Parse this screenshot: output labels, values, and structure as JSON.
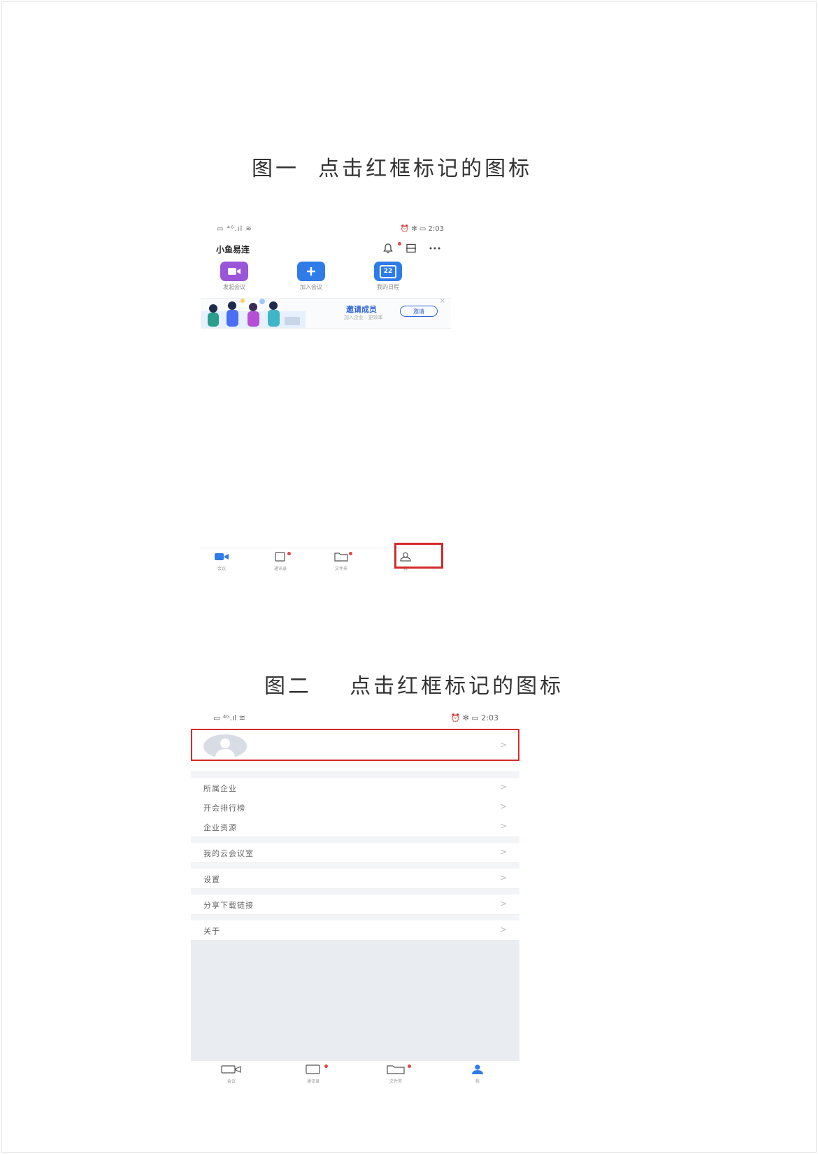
{
  "captions": {
    "fig1": "图一  点击红框标记的图标",
    "fig2": "图二    点击红框标记的图标"
  },
  "screen1": {
    "status": {
      "left": "▭ ⁴ᴳ.ıl ≋",
      "right": "⏰ ✻ ▭ 2:03"
    },
    "app_title": "小鱼易连",
    "quick_actions": [
      {
        "label": "发起会议",
        "icon": "video-camera-icon",
        "color": "#9b55d8"
      },
      {
        "label": "加入会议",
        "icon": "plus-icon",
        "color": "#2f7be8"
      },
      {
        "label": "我的日程",
        "icon": "calendar-icon",
        "color": "#2f7be8",
        "badge": "22"
      }
    ],
    "banner": {
      "title": "邀请成员",
      "subtitle": "加入企业 · 更效率",
      "button": "邀请",
      "close": "×"
    },
    "tabs": [
      {
        "label": "会议",
        "icon": "camera-tab-icon",
        "active": true,
        "dot": false
      },
      {
        "label": "通讯录",
        "icon": "contacts-tab-icon",
        "active": false,
        "dot": true
      },
      {
        "label": "文件夹",
        "icon": "folder-tab-icon",
        "active": false,
        "dot": true
      },
      {
        "label": "我",
        "icon": "person-tab-icon",
        "active": false,
        "dot": false,
        "highlighted": true
      }
    ]
  },
  "screen2": {
    "status": {
      "left": "▭ ⁴ᴳ.ıl ≋",
      "right": "⏰ ✻ ▭ 2:03"
    },
    "chevron": ">",
    "menu_groups": [
      [
        "所属企业",
        "开会排行榜",
        "企业资源"
      ],
      [
        "我的云会议室"
      ],
      [
        "设置"
      ],
      [
        "分享下载链接"
      ],
      [
        "关于"
      ]
    ],
    "tabs": [
      {
        "label": "会议",
        "icon": "camera-tab-icon",
        "active": false,
        "dot": false
      },
      {
        "label": "通讯录",
        "icon": "contacts-tab-icon",
        "active": false,
        "dot": true
      },
      {
        "label": "文件夹",
        "icon": "folder-tab-icon",
        "active": false,
        "dot": true
      },
      {
        "label": "我",
        "icon": "person-tab-icon",
        "active": true,
        "dot": false
      }
    ]
  },
  "colors": {
    "highlight_red": "#d42a2a",
    "brand_blue": "#2f7be8"
  }
}
